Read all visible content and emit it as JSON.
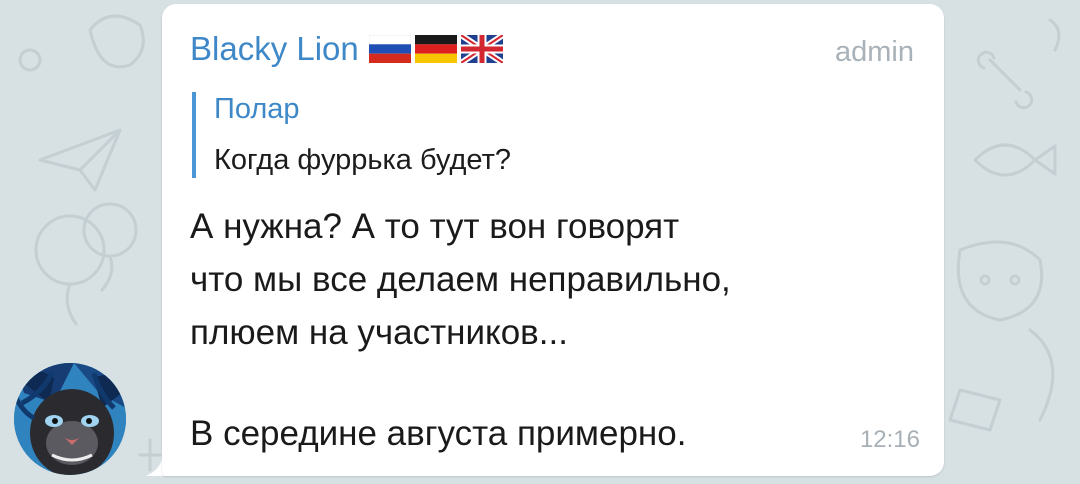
{
  "chat": {
    "sender": {
      "name": "Blacky Lion",
      "flags": [
        "flag-russia-icon",
        "flag-germany-icon",
        "flag-uk-icon"
      ],
      "role": "admin"
    },
    "reply": {
      "author": "Полар",
      "text": "Когда фуррька будет?"
    },
    "message": {
      "lines": [
        "А нужна? А то тут вон говорят",
        "что мы все делаем неправильно,",
        "плюем на участников...",
        "В середине августа примерно."
      ],
      "time": "12:16"
    },
    "avatar": {
      "icon": "panther-avatar-icon"
    }
  },
  "colors": {
    "background": "#d7e0e3",
    "bubble": "#ffffff",
    "accent": "#3e88c8",
    "meta": "#a9b2b8"
  }
}
